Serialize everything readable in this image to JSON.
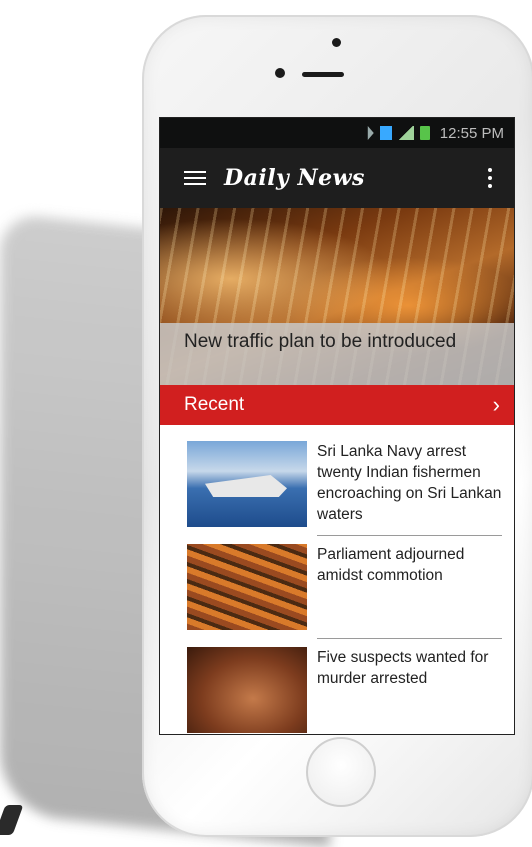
{
  "statusbar": {
    "time": "12:55 PM"
  },
  "appbar": {
    "brand": "Daily News"
  },
  "hero": {
    "caption": "New traffic plan to be introduced"
  },
  "section": {
    "title": "Recent",
    "chevron": "›"
  },
  "recent": [
    {
      "title": "Sri Lanka Navy arrest twenty Indian fishermen encroaching on Sri Lankan waters"
    },
    {
      "title": "Parliament adjourned amidst commotion"
    },
    {
      "title": "Five suspects wanted for murder arrested"
    }
  ],
  "icons": {
    "menu": "hamburger-icon",
    "overflow": "more-vert-icon"
  },
  "colors": {
    "accent": "#d11f1f",
    "appbar": "#1e1e1e",
    "statusbar": "#0f1010"
  }
}
